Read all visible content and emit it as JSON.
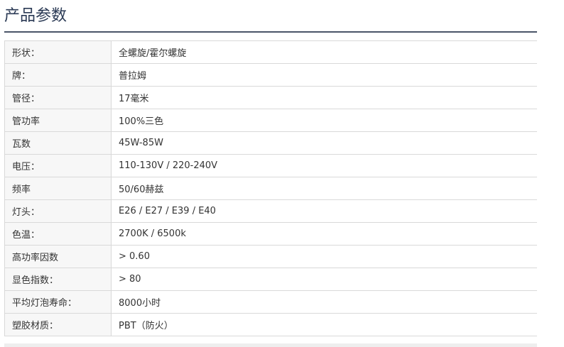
{
  "section": {
    "title": "产品参数"
  },
  "specs": [
    {
      "label": "形状：",
      "value": "全螺旋/霍尔螺旋"
    },
    {
      "label": "牌：",
      "value": "普拉姆"
    },
    {
      "label": "管径：",
      "value": "17毫米"
    },
    {
      "label": "管功率",
      "value": "100%三色"
    },
    {
      "label": "瓦数",
      "value": "45W-85W"
    },
    {
      "label": "电压：",
      "value": "110-130V / 220-240V"
    },
    {
      "label": "频率",
      "value": "50/60赫兹"
    },
    {
      "label": "灯头：",
      "value": "E26 / E27 / E39 / E40"
    },
    {
      "label": "色温：",
      "value": "2700K / 6500k"
    },
    {
      "label": "高功率因数",
      "value": "> 0.60"
    },
    {
      "label": "显色指数：",
      "value": "> 80"
    },
    {
      "label": "平均灯泡寿命：",
      "value": "8000小时"
    },
    {
      "label": "塑胶材质：",
      "value": "PBT（防火）"
    }
  ]
}
